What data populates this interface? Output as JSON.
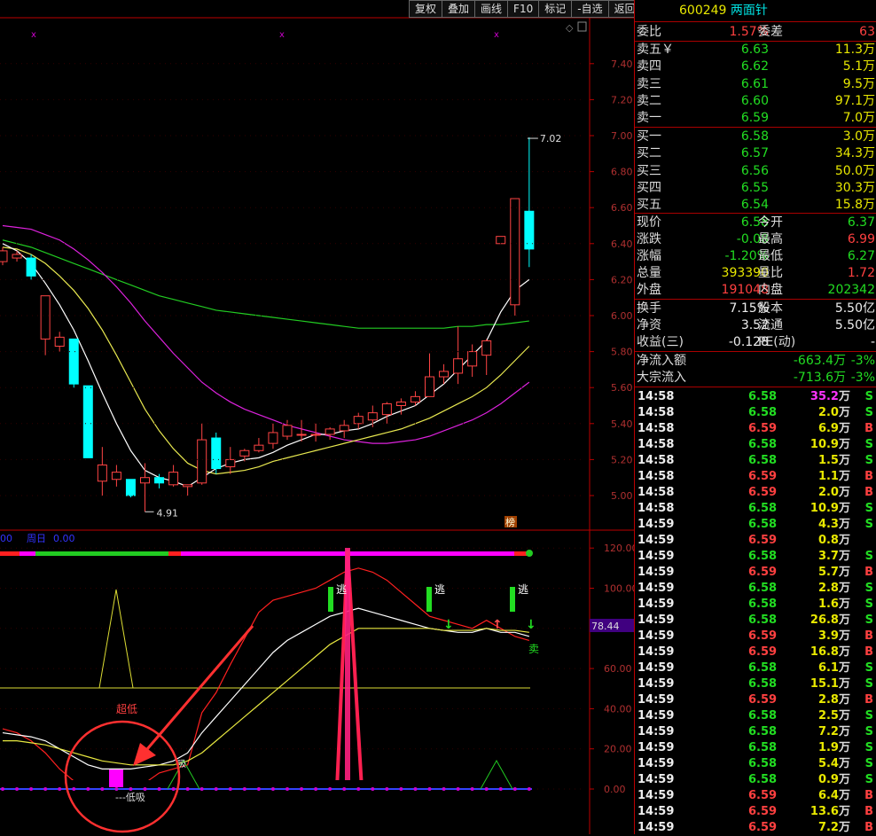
{
  "toolbar": {
    "buttons": [
      "复权",
      "叠加",
      "画线",
      "F10",
      "标记",
      "-自选",
      "返回"
    ]
  },
  "stock": {
    "code": "600249",
    "name": "两面针"
  },
  "quote_header": {
    "label1": "委比",
    "val1": "1.57%",
    "label2": "委差",
    "val2": "63"
  },
  "asks": [
    {
      "label": "卖五￥",
      "price": "6.63",
      "vol": "11.3万"
    },
    {
      "label": "卖四",
      "price": "6.62",
      "vol": "5.1万"
    },
    {
      "label": "卖三",
      "price": "6.61",
      "vol": "9.5万"
    },
    {
      "label": "卖二",
      "price": "6.60",
      "vol": "97.1万"
    },
    {
      "label": "卖一",
      "price": "6.59",
      "vol": "7.0万"
    }
  ],
  "bids": [
    {
      "label": "买一",
      "price": "6.58",
      "vol": "3.0万"
    },
    {
      "label": "买二",
      "price": "6.57",
      "vol": "34.3万"
    },
    {
      "label": "买三",
      "price": "6.56",
      "vol": "50.0万"
    },
    {
      "label": "买四",
      "price": "6.55",
      "vol": "30.3万"
    },
    {
      "label": "买五",
      "price": "6.54",
      "vol": "15.8万"
    }
  ],
  "stats": [
    {
      "l1": "现价",
      "v1": "6.58",
      "c1": "green",
      "l2": "今开",
      "v2": "6.37",
      "c2": "green"
    },
    {
      "l1": "涨跌",
      "v1": "-0.08",
      "c1": "green",
      "l2": "最高",
      "v2": "6.99",
      "c2": "red"
    },
    {
      "l1": "涨幅",
      "v1": "-1.20%",
      "c1": "green",
      "l2": "最低",
      "v2": "6.27",
      "c2": "green"
    },
    {
      "l1": "总量",
      "v1": "393390",
      "c1": "yellow",
      "l2": "量比",
      "v2": "1.72",
      "c2": "red"
    },
    {
      "l1": "外盘",
      "v1": "191048",
      "c1": "red",
      "l2": "内盘",
      "v2": "202342",
      "c2": "green"
    }
  ],
  "fund": [
    {
      "l1": "换手",
      "v1": "7.15%",
      "l2": "股本",
      "v2": "5.50亿"
    },
    {
      "l1": "净资",
      "v1": "3.52",
      "l2": "流通",
      "v2": "5.50亿"
    },
    {
      "l1": "收益(三)",
      "v1": "-0.128",
      "l2": "PE(动)",
      "v2": "-"
    }
  ],
  "flow": [
    {
      "label": "净流入额",
      "value": "-663.4万",
      "pct": "-3%"
    },
    {
      "label": "大宗流入",
      "value": "-713.6万",
      "pct": "-3%"
    }
  ],
  "ticks": [
    {
      "t": "14:58",
      "p": "6.58",
      "v": "35.2",
      "s": "S"
    },
    {
      "t": "14:58",
      "p": "6.58",
      "v": "2.0",
      "s": "S"
    },
    {
      "t": "14:58",
      "p": "6.59",
      "v": "6.9",
      "s": "B"
    },
    {
      "t": "14:58",
      "p": "6.58",
      "v": "10.9",
      "s": "S"
    },
    {
      "t": "14:58",
      "p": "6.58",
      "v": "1.5",
      "s": "S"
    },
    {
      "t": "14:58",
      "p": "6.59",
      "v": "1.1",
      "s": "B"
    },
    {
      "t": "14:58",
      "p": "6.59",
      "v": "2.0",
      "s": "B"
    },
    {
      "t": "14:58",
      "p": "6.58",
      "v": "10.9",
      "s": "S"
    },
    {
      "t": "14:59",
      "p": "6.58",
      "v": "4.3",
      "s": "S"
    },
    {
      "t": "14:59",
      "p": "6.59",
      "v": "0.8",
      "s": ""
    },
    {
      "t": "14:59",
      "p": "6.58",
      "v": "3.7",
      "s": "S"
    },
    {
      "t": "14:59",
      "p": "6.59",
      "v": "5.7",
      "s": "B"
    },
    {
      "t": "14:59",
      "p": "6.58",
      "v": "2.8",
      "s": "S"
    },
    {
      "t": "14:59",
      "p": "6.58",
      "v": "1.6",
      "s": "S"
    },
    {
      "t": "14:59",
      "p": "6.58",
      "v": "26.8",
      "s": "S"
    },
    {
      "t": "14:59",
      "p": "6.59",
      "v": "3.9",
      "s": "B"
    },
    {
      "t": "14:59",
      "p": "6.59",
      "v": "16.8",
      "s": "B"
    },
    {
      "t": "14:59",
      "p": "6.58",
      "v": "6.1",
      "s": "S"
    },
    {
      "t": "14:59",
      "p": "6.58",
      "v": "15.1",
      "s": "S"
    },
    {
      "t": "14:59",
      "p": "6.59",
      "v": "2.8",
      "s": "B"
    },
    {
      "t": "14:59",
      "p": "6.58",
      "v": "2.5",
      "s": "S"
    },
    {
      "t": "14:59",
      "p": "6.58",
      "v": "7.2",
      "s": "S"
    },
    {
      "t": "14:59",
      "p": "6.58",
      "v": "1.9",
      "s": "S"
    },
    {
      "t": "14:59",
      "p": "6.58",
      "v": "5.4",
      "s": "S"
    },
    {
      "t": "14:59",
      "p": "6.58",
      "v": "0.9",
      "s": "S"
    },
    {
      "t": "14:59",
      "p": "6.59",
      "v": "6.4",
      "s": "B"
    },
    {
      "t": "14:59",
      "p": "6.59",
      "v": "13.6",
      "s": "B"
    },
    {
      "t": "14:59",
      "p": "6.59",
      "v": "7.2",
      "s": "B"
    }
  ],
  "tick_unit": "万",
  "main_chart": {
    "price_ticks": [
      "7.40",
      "7.20",
      "7.00",
      "6.80",
      "6.60",
      "6.40",
      "6.20",
      "6.00",
      "5.80",
      "5.60",
      "5.40",
      "5.20",
      "5.00"
    ],
    "high_label": "7.02",
    "low_label": "4.91",
    "badge": "榜",
    "candles": [
      {
        "o": 6.3,
        "h": 6.38,
        "l": 6.28,
        "c": 6.36
      },
      {
        "o": 6.32,
        "h": 6.36,
        "l": 6.3,
        "c": 6.34
      },
      {
        "o": 6.32,
        "h": 6.34,
        "l": 6.2,
        "c": 6.22
      },
      {
        "o": 5.87,
        "h": 6.07,
        "l": 5.78,
        "c": 6.11
      },
      {
        "o": 5.83,
        "h": 5.91,
        "l": 5.8,
        "c": 5.88
      },
      {
        "o": 5.87,
        "h": 5.87,
        "l": 5.6,
        "c": 5.62
      },
      {
        "o": 5.61,
        "h": 5.61,
        "l": 5.21,
        "c": 5.21
      },
      {
        "o": 5.08,
        "h": 5.27,
        "l": 5.0,
        "c": 5.17
      },
      {
        "o": 5.09,
        "h": 5.17,
        "l": 5.05,
        "c": 5.13
      },
      {
        "o": 5.09,
        "h": 5.09,
        "l": 4.99,
        "c": 5.0
      },
      {
        "o": 5.07,
        "h": 5.18,
        "l": 4.91,
        "c": 5.1
      },
      {
        "o": 5.1,
        "h": 5.12,
        "l": 5.04,
        "c": 5.07
      },
      {
        "o": 5.06,
        "h": 5.17,
        "l": 5.05,
        "c": 5.13
      },
      {
        "o": 5.05,
        "h": 5.05,
        "l": 5.0,
        "c": 5.06
      },
      {
        "o": 5.07,
        "h": 5.4,
        "l": 5.06,
        "c": 5.31
      },
      {
        "o": 5.32,
        "h": 5.35,
        "l": 5.12,
        "c": 5.15
      },
      {
        "o": 5.16,
        "h": 5.27,
        "l": 5.12,
        "c": 5.2
      },
      {
        "o": 5.22,
        "h": 5.26,
        "l": 5.19,
        "c": 5.25
      },
      {
        "o": 5.25,
        "h": 5.32,
        "l": 5.24,
        "c": 5.28
      },
      {
        "o": 5.29,
        "h": 5.4,
        "l": 5.26,
        "c": 5.35
      },
      {
        "o": 5.33,
        "h": 5.42,
        "l": 5.31,
        "c": 5.39
      },
      {
        "o": 5.34,
        "h": 5.42,
        "l": 5.3,
        "c": 5.34
      },
      {
        "o": 5.34,
        "h": 5.4,
        "l": 5.3,
        "c": 5.34
      },
      {
        "o": 5.34,
        "h": 5.38,
        "l": 5.31,
        "c": 5.37
      },
      {
        "o": 5.36,
        "h": 5.42,
        "l": 5.32,
        "c": 5.39
      },
      {
        "o": 5.4,
        "h": 5.46,
        "l": 5.37,
        "c": 5.44
      },
      {
        "o": 5.42,
        "h": 5.5,
        "l": 5.38,
        "c": 5.46
      },
      {
        "o": 5.45,
        "h": 5.52,
        "l": 5.4,
        "c": 5.51
      },
      {
        "o": 5.5,
        "h": 5.54,
        "l": 5.45,
        "c": 5.52
      },
      {
        "o": 5.52,
        "h": 5.58,
        "l": 5.5,
        "c": 5.55
      },
      {
        "o": 5.55,
        "h": 5.79,
        "l": 5.55,
        "c": 5.66
      },
      {
        "o": 5.66,
        "h": 5.73,
        "l": 5.62,
        "c": 5.69
      },
      {
        "o": 5.68,
        "h": 5.94,
        "l": 5.62,
        "c": 5.76
      },
      {
        "o": 5.72,
        "h": 5.84,
        "l": 5.66,
        "c": 5.8
      },
      {
        "o": 5.78,
        "h": 5.87,
        "l": 5.67,
        "c": 5.86
      },
      {
        "o": 6.4,
        "h": 6.44,
        "l": 6.4,
        "c": 6.44
      },
      {
        "o": 6.06,
        "h": 6.44,
        "l": 6.0,
        "c": 6.65
      },
      {
        "o": 6.58,
        "h": 6.99,
        "l": 6.27,
        "c": 6.37
      }
    ],
    "ma5": [
      6.4,
      6.36,
      6.29,
      6.18,
      6.06,
      5.92,
      5.75,
      5.57,
      5.4,
      5.25,
      5.14,
      5.1,
      5.08,
      5.05,
      5.1,
      5.15,
      5.18,
      5.2,
      5.21,
      5.24,
      5.28,
      5.31,
      5.34,
      5.34,
      5.36,
      5.37,
      5.4,
      5.44,
      5.47,
      5.5,
      5.56,
      5.62,
      5.7,
      5.78,
      5.86,
      6.02,
      6.14,
      6.2
    ],
    "ma10": [
      6.38,
      6.37,
      6.34,
      6.29,
      6.22,
      6.14,
      6.04,
      5.92,
      5.78,
      5.63,
      5.48,
      5.36,
      5.26,
      5.18,
      5.14,
      5.12,
      5.13,
      5.14,
      5.16,
      5.19,
      5.21,
      5.23,
      5.25,
      5.27,
      5.29,
      5.31,
      5.33,
      5.35,
      5.37,
      5.4,
      5.43,
      5.47,
      5.51,
      5.55,
      5.6,
      5.67,
      5.75,
      5.83
    ],
    "ma20": [
      6.5,
      6.49,
      6.48,
      6.45,
      6.42,
      6.37,
      6.31,
      6.24,
      6.16,
      6.07,
      5.97,
      5.88,
      5.79,
      5.71,
      5.63,
      5.57,
      5.52,
      5.48,
      5.45,
      5.42,
      5.39,
      5.37,
      5.35,
      5.33,
      5.31,
      5.3,
      5.29,
      5.29,
      5.3,
      5.31,
      5.33,
      5.36,
      5.39,
      5.42,
      5.46,
      5.51,
      5.57,
      5.63
    ],
    "ma60": [
      6.42,
      6.4,
      6.38,
      6.35,
      6.32,
      6.29,
      6.26,
      6.23,
      6.2,
      6.17,
      6.14,
      6.11,
      6.09,
      6.07,
      6.05,
      6.03,
      6.02,
      6.01,
      6.0,
      5.99,
      5.98,
      5.97,
      5.96,
      5.95,
      5.94,
      5.93,
      5.93,
      5.93,
      5.93,
      5.93,
      5.93,
      5.93,
      5.94,
      5.94,
      5.95,
      5.95,
      5.96,
      5.97
    ]
  },
  "sub_chart": {
    "label_left": "00",
    "label_period": "周日",
    "label_val": "0.00",
    "y_ticks": [
      "120.00",
      "100.00",
      "80.00",
      "60.00",
      "40.00",
      "20.00",
      "0.00"
    ],
    "current_value": "78.44",
    "escape_labels": [
      "逃",
      "逃",
      "逃"
    ],
    "chaodi": "超低",
    "dixi": "---低吸",
    "sell": "卖",
    "side_label": "吸",
    "red_line": [
      30,
      28,
      24,
      18,
      10,
      4,
      1,
      0,
      0,
      1,
      3,
      8,
      10,
      12,
      38,
      48,
      62,
      75,
      88,
      94,
      96,
      98,
      100,
      104,
      108,
      110,
      108,
      104,
      98,
      92,
      86,
      84,
      82,
      80,
      84,
      80,
      76,
      74
    ],
    "white_line": [
      28,
      27,
      26,
      24,
      20,
      16,
      12,
      10,
      10,
      10,
      11,
      12,
      14,
      18,
      28,
      36,
      44,
      52,
      60,
      68,
      74,
      78,
      82,
      86,
      88,
      90,
      88,
      86,
      84,
      82,
      80,
      79,
      78,
      78,
      80,
      78,
      78,
      76
    ],
    "yellow_line": [
      24,
      24,
      23,
      22,
      20,
      18,
      16,
      14,
      13,
      12,
      12,
      12,
      12,
      14,
      18,
      24,
      30,
      36,
      42,
      48,
      54,
      60,
      66,
      72,
      76,
      80,
      80,
      80,
      80,
      80,
      80,
      79,
      79,
      79,
      80,
      79,
      79,
      78
    ],
    "yellow_tri": [
      50,
      50,
      50,
      50,
      50,
      50,
      50,
      100,
      50,
      50,
      50,
      50,
      50,
      50,
      50,
      50,
      50,
      50,
      50,
      50,
      50,
      50,
      50,
      50,
      50,
      50,
      50,
      50,
      50,
      50,
      50,
      50,
      50,
      50,
      50,
      50,
      50,
      50
    ]
  }
}
